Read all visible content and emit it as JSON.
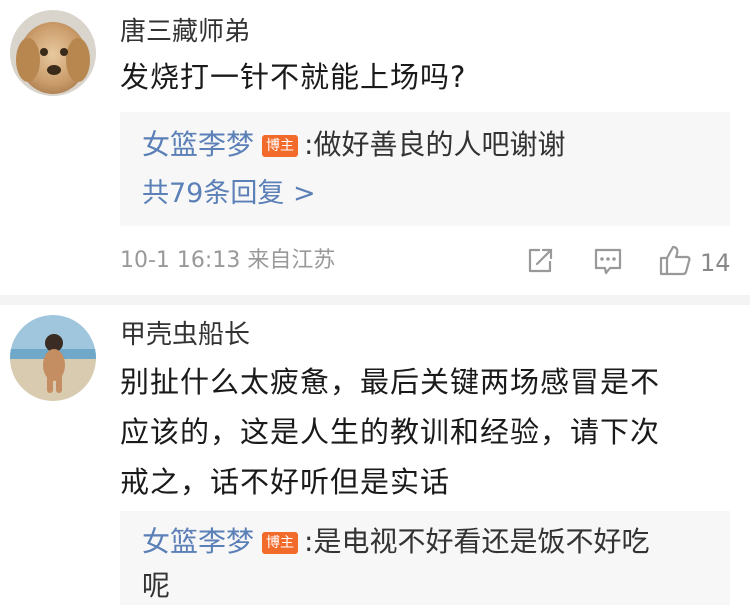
{
  "comments": [
    {
      "username": "唐三藏师弟",
      "text": "发烧打一针不就能上场吗?",
      "reply": {
        "author": "女篮李梦",
        "badge": "博主",
        "text": ":做好善良的人吧谢谢",
        "more": "共79条回复 >"
      },
      "meta": "10-1 16:13 来自江苏",
      "like_count": "14",
      "icons": [
        "share-icon",
        "comment-icon",
        "like-icon"
      ]
    },
    {
      "username": "甲壳虫船长",
      "text_lines": [
        "别扯什么太疲惫，最后关键两场感冒是不",
        "应该的，这是人生的教训和经验，请下次",
        "戒之，话不好听但是实话"
      ],
      "reply": {
        "author": "女篮李梦",
        "badge": "博主",
        "text_line1": ":是电视不好看还是饭不好吃",
        "text_line2": "呢"
      }
    }
  ],
  "colors": {
    "link": "#5b7fb7",
    "badge": "#f26b2b",
    "reply_bg": "#f7f7f7"
  }
}
